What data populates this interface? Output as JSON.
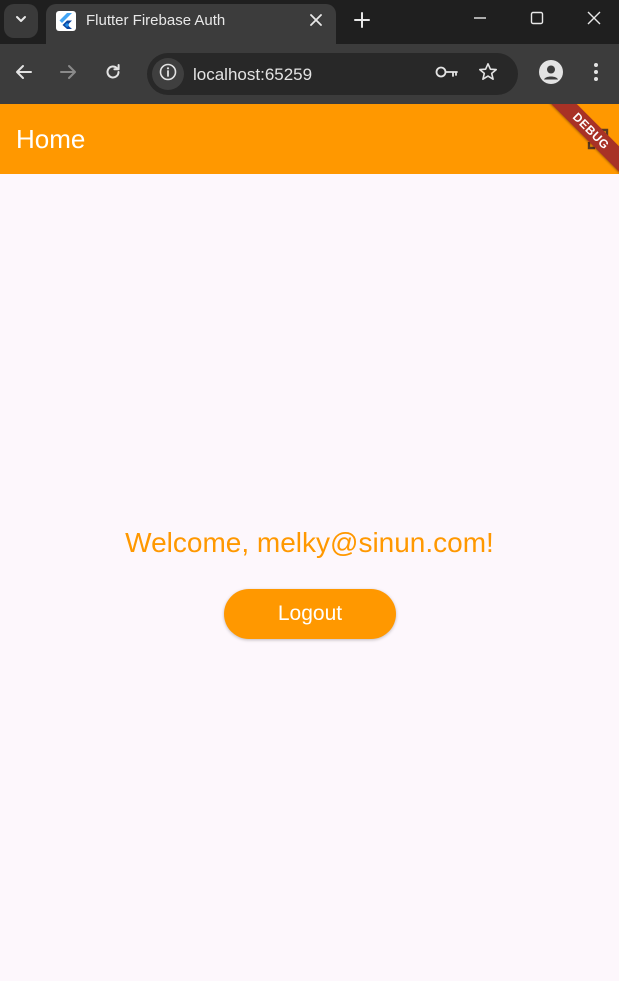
{
  "browser": {
    "tab": {
      "title": "Flutter Firebase Auth"
    },
    "address_bar": {
      "url": "localhost:65259"
    }
  },
  "app": {
    "appbar": {
      "title": "Home"
    },
    "debug_banner": "DEBUG",
    "welcome_text": "Welcome, melky@sinun.com!",
    "logout_label": "Logout",
    "accent_color": "#ff9800",
    "background_color": "#fdf7fc"
  },
  "icons": {
    "tab_search": "chevron-down-icon",
    "favicon": "flutter-logo-icon",
    "tab_close": "close-icon",
    "new_tab": "plus-icon",
    "minimize": "minimize-icon",
    "maximize": "maximize-icon",
    "window_close": "close-icon",
    "back": "arrow-left-icon",
    "forward": "arrow-right-icon",
    "reload": "reload-icon",
    "site_info": "info-icon",
    "passwords": "key-icon",
    "bookmark": "star-icon",
    "profile": "profile-icon",
    "menu": "kebab-menu-icon",
    "fullscreen": "fullscreen-icon"
  }
}
